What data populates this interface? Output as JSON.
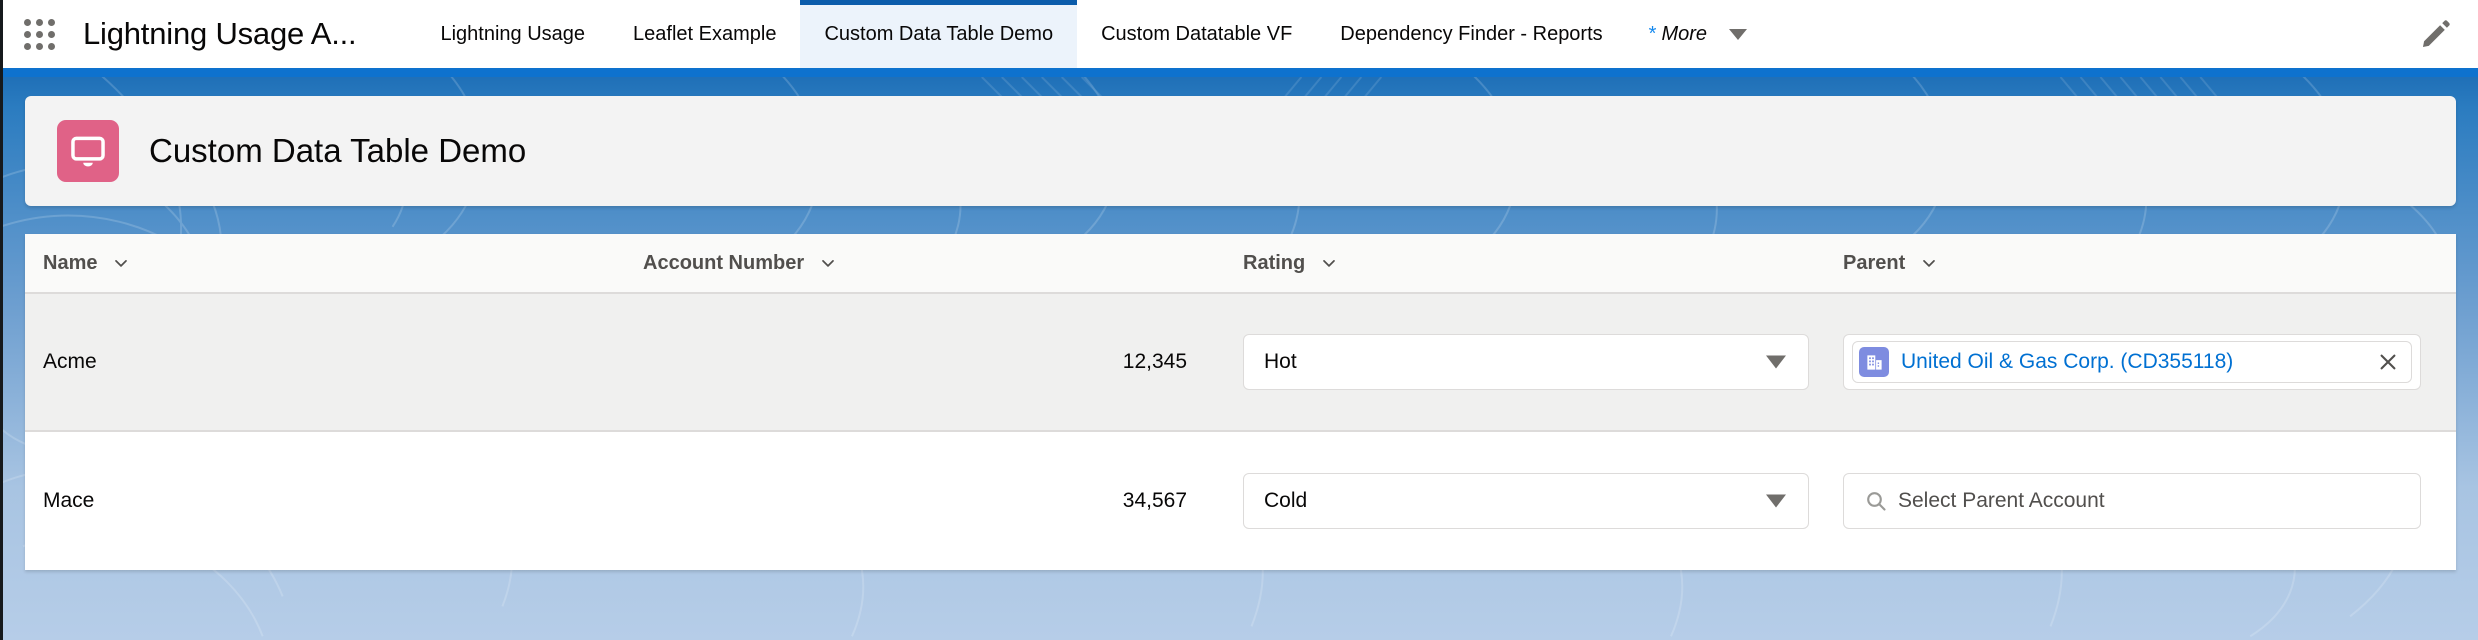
{
  "header": {
    "app_launcher_icon": "waffle-grid-icon",
    "app_name": "Lightning Usage A...",
    "tabs": [
      {
        "label": "Lightning Usage",
        "active": false
      },
      {
        "label": "Leaflet Example",
        "active": false
      },
      {
        "label": "Custom Data Table Demo",
        "active": true
      },
      {
        "label": "Custom Datatable VF",
        "active": false
      },
      {
        "label": "Dependency Finder - Reports",
        "active": false
      }
    ],
    "more": {
      "star": "*",
      "label": "More",
      "caret_icon": "chevron-down-icon"
    },
    "edit_icon": "pencil-icon"
  },
  "page": {
    "icon": "desktop-monitor-icon",
    "icon_color": "#e06287",
    "title": "Custom Data Table Demo"
  },
  "table": {
    "columns": [
      {
        "label": "Name",
        "sort_icon": "chevron-down-icon"
      },
      {
        "label": "Account Number",
        "sort_icon": "chevron-down-icon"
      },
      {
        "label": "Rating",
        "sort_icon": "chevron-down-icon"
      },
      {
        "label": "Parent",
        "sort_icon": "chevron-down-icon"
      }
    ],
    "rows": [
      {
        "name": "Acme",
        "account_number": "12,345",
        "rating": "Hot",
        "parent_kind": "pill",
        "parent_label": "United Oil & Gas Corp. (CD355118)",
        "parent_icon": "account-building-icon",
        "remove_icon": "close-icon"
      },
      {
        "name": "Mace",
        "account_number": "34,567",
        "rating": "Cold",
        "parent_kind": "search",
        "parent_placeholder": "Select Parent Account",
        "search_icon": "search-icon"
      }
    ]
  },
  "colors": {
    "accent_blue": "#0070d2",
    "active_tab_bar": "#0b5cab",
    "active_tab_bg": "#ecf3fb",
    "theme_blue": "#0e72ce",
    "object_icon": "#e06287",
    "pill_icon": "#7e8ce0"
  }
}
